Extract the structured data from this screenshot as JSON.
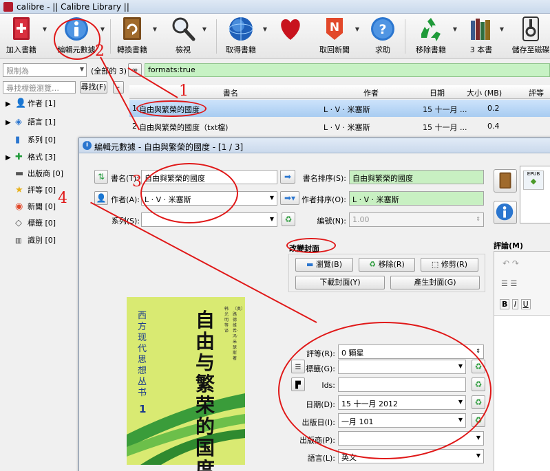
{
  "window": {
    "title": "calibre - || Calibre Library ||"
  },
  "toolbar": {
    "items": [
      {
        "label": "加入書籍",
        "icon": "add-book-icon"
      },
      {
        "label": "編輯元數據",
        "icon": "info-icon"
      },
      {
        "label": "轉換書籍",
        "icon": "convert-book-icon"
      },
      {
        "label": "檢視",
        "icon": "magnifier-icon"
      },
      {
        "label": "取得書籍",
        "icon": "globe-icon"
      },
      {
        "label": "",
        "icon": "heart-icon"
      },
      {
        "label": "取回新聞",
        "icon": "news-icon"
      },
      {
        "label": "求助",
        "icon": "help-icon"
      },
      {
        "label": "移除書籍",
        "icon": "recycle-icon"
      },
      {
        "label": "3 本書",
        "icon": "library-icon"
      },
      {
        "label": "儲存至磁碟",
        "icon": "save-disk-icon"
      }
    ]
  },
  "search": {
    "restrict_placeholder": "限制為",
    "all_count": "(全部的 3)",
    "query": "formats:true",
    "tag_browser_placeholder": "尋找標籤瀏覽…",
    "find_label": "尋找(F)",
    "minus_label": "-"
  },
  "sidebar": {
    "items": [
      {
        "label": "作者 [1]",
        "expandable": true
      },
      {
        "label": "語言 [1]",
        "expandable": true
      },
      {
        "label": "系列 [0]",
        "expandable": false
      },
      {
        "label": "格式 [3]",
        "expandable": true
      },
      {
        "label": "出版商 [0]",
        "expandable": false
      },
      {
        "label": "評等 [0]",
        "expandable": false
      },
      {
        "label": "新聞 [0]",
        "expandable": false
      },
      {
        "label": "標籤 [0]",
        "expandable": false
      },
      {
        "label": "識別 [0]",
        "expandable": false
      }
    ]
  },
  "table": {
    "headers": {
      "title": "書名",
      "author": "作者",
      "date": "日期",
      "size": "大小 (MB)",
      "rating": "評等"
    },
    "rows": [
      {
        "num": "1",
        "title": "自由與繁榮的國度",
        "author": "L · V · 米塞斯",
        "date": "15 十一月 ...",
        "size": "0.2"
      },
      {
        "num": "2",
        "title": "自由與繁榮的國度（txt檔)",
        "author": "L · V · 米塞斯",
        "date": "15 十一月 ...",
        "size": "0.4"
      }
    ]
  },
  "dialog": {
    "title": "編輯元數據 - 自由與繁榮的國度 - [1 / 3]",
    "title_label": "書名(T):",
    "title_value": "自由與繁榮的國度",
    "title_sort_label": "書名排序(S):",
    "title_sort_value": "自由與繁榮的國度",
    "author_label": "作者(A):",
    "author_value": "L · V · 米塞斯",
    "author_sort_label": "作者排序(O):",
    "author_sort_value": "L · V · 米塞斯",
    "series_label": "系列(S):",
    "series_value": "",
    "series_index_label": "編號(N):",
    "series_index_value": "1.00",
    "cover_group_label": "改變封面",
    "browse_label": "瀏覽(B)",
    "remove_label": "移除(R)",
    "trim_label": "修剪(R)",
    "download_cover_label": "下載封面(Y)",
    "generate_cover_label": "產生封面(G)",
    "rating_label": "評等(R):",
    "rating_value": "0 顆星",
    "tags_label": "標籤(G):",
    "tags_value": "",
    "ids_label": "Ids:",
    "ids_value": "",
    "date_label": "日期(D):",
    "date_value": "15 十一月 2012",
    "pubdate_label": "出版日(I):",
    "pubdate_value": "一月 101",
    "publisher_label": "出版商(P):",
    "publisher_value": "",
    "language_label": "語言(L):",
    "language_value": "英文",
    "comments_label": "評論(M)",
    "format_label": "EPUB",
    "cover_text": {
      "main": "自由与繁荣的国度",
      "series": "西方现代思想丛书",
      "num": "1",
      "authors": "〔奥〕路德维希·冯·米瑟斯 著",
      "translator": "韩光明 等译"
    }
  },
  "annotations": {
    "n1": "1",
    "n2": "2",
    "n3": "3",
    "n4": "4"
  },
  "colors": {
    "annotation": "#e01818",
    "selection": "#a8ccf1",
    "green_field": "#c8f0c2",
    "cover_bg": "#d9ea72"
  }
}
